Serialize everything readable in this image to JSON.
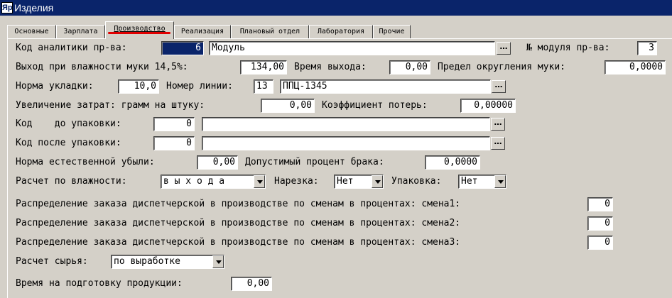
{
  "window": {
    "title": "Изделия"
  },
  "tabs": [
    "Основные",
    "Зарплата",
    "Производство",
    "Реализация",
    "Плановый отдел",
    "Лаборатория",
    "Прочие"
  ],
  "form": {
    "analytics_code_label": "Код аналитики пр-ва:",
    "analytics_code_value": "6",
    "analytics_name": "Модуль",
    "module_no_label": "№ модуля пр-ва:",
    "module_no_value": "3",
    "yield_label": "Выход при влажности муки 14,5%:",
    "yield_value": "134,00",
    "exit_time_label": "Время выхода:",
    "exit_time_value": "0,00",
    "rounding_label": "Предел округления муки:",
    "rounding_value": "0,0000",
    "laying_label": "Норма укладки:",
    "laying_value": "10,0",
    "line_label": "Номер линии:",
    "line_no": "13",
    "line_name": "ППЦ-1345",
    "cost_inc_label": "Увеличение затрат: грамм на штуку:",
    "cost_inc_value": "0,00",
    "loss_coef_label": "Коэффициент потерь:",
    "loss_coef_value": "0,00000",
    "code_before_label": "Код    до упаковки:",
    "code_before_value": "0",
    "code_before_name": "",
    "code_after_label": "Код после упаковки:",
    "code_after_value": "0",
    "code_after_name": "",
    "natural_loss_label": "Норма естественной убыли:",
    "natural_loss_value": "0,00",
    "defect_label": "Допустимый процент брака:",
    "defect_value": "0,0000",
    "humidity_calc_label": "Расчет по влажности:",
    "humidity_calc_value": "в ы х о д а",
    "slicing_label": "Нарезка:",
    "slicing_value": "Нет",
    "packing_label": "Упаковка:",
    "packing_value": "Нет",
    "shift1_label": "Распределение заказа диспетчерской в производстве по сменам в процентах: смена1:",
    "shift1_value": "0",
    "shift2_label": "Распределение заказа диспетчерской в производстве по сменам в процентах: смена2:",
    "shift2_value": "0",
    "shift3_label": "Распределение заказа диспетчерской в производстве по сменам в процентах: смена3:",
    "shift3_value": "0",
    "raw_calc_label": "Расчет сырья:",
    "raw_calc_value": "по выработке",
    "prep_time_label": "Время на подготовку продукции:",
    "prep_time_value": "0,00"
  }
}
